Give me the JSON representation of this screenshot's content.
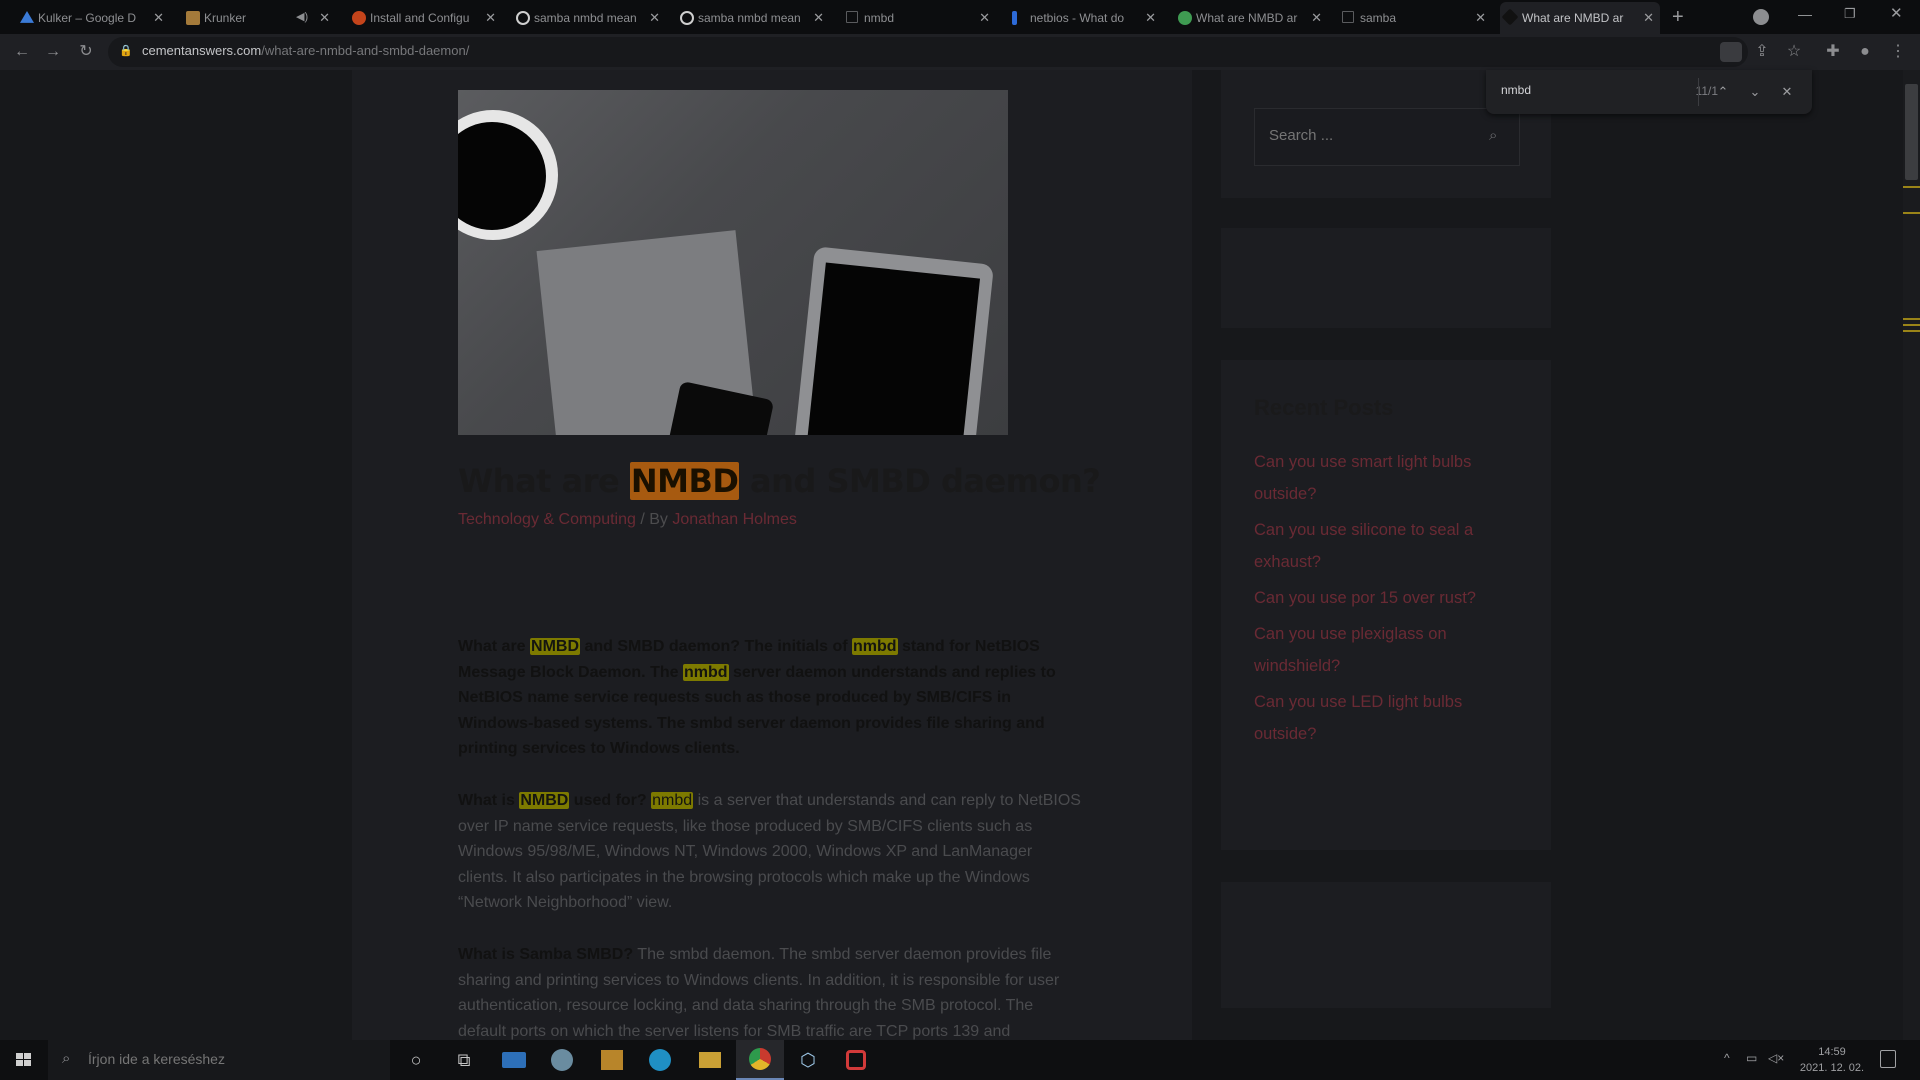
{
  "tabs": [
    {
      "label": "Kulker – Google D",
      "favicon": "google-drive-icon",
      "color": "#3b7bd8"
    },
    {
      "label": "Krunker",
      "favicon": "krunker-icon",
      "color": "#a47a3a",
      "muted_icon": "speaker-icon"
    },
    {
      "label": "Install and Configu",
      "favicon": "ubuntu-icon",
      "color": "#c4441b"
    },
    {
      "label": "samba nmbd mean",
      "favicon": "google-icon",
      "color": "#d8d8d8"
    },
    {
      "label": "samba nmbd mean",
      "favicon": "google-icon",
      "color": "#d8d8d8"
    },
    {
      "label": "nmbd",
      "favicon": "doc-icon",
      "color": "#3a3b3e"
    },
    {
      "label": "netbios - What do",
      "favicon": "serverfault-icon",
      "color": "#2d6ad8"
    },
    {
      "label": "What are NMBD ar",
      "favicon": "globe-icon",
      "color": "#3f9b52"
    },
    {
      "label": "samba",
      "favicon": "doc-icon",
      "color": "#3a3b3e"
    },
    {
      "label": "What are NMBD ar",
      "favicon": "site-icon",
      "color": "#4a4a4a",
      "active": true
    }
  ],
  "address_bar": {
    "domain": "cementanswers.com",
    "path": "/what-are-nmbd-and-smbd-daemon/"
  },
  "find_bar": {
    "query": "nmbd",
    "count": "11/1"
  },
  "article": {
    "title_prefix": "What are ",
    "title_highlight": "NMBD",
    "title_suffix": " and SMBD daemon?",
    "category": "Technology & Computing",
    "by": " / By ",
    "author": "Jonathan Holmes",
    "p1": {
      "a": "What are ",
      "b": "NMBD",
      "c": " and SMBD daemon? The initials of ",
      "d": "nmbd",
      "e": " stand for NetBIOS Message Block Daemon. The ",
      "f": "nmbd",
      "g": " server daemon understands and replies to NetBIOS name service requests such as those produced by SMB/CIFS in Windows-based systems. The smbd server daemon provides file sharing and printing services to Windows clients."
    },
    "p2": {
      "q1": "What is ",
      "q2": "NMBD",
      "q3": " used for?",
      "h": "nmbd",
      "rest": " is a server that understands and can reply to NetBIOS over IP name service requests, like those produced by SMB/CIFS clients such as Windows 95/98/ME, Windows NT, Windows 2000, Windows XP and LanManager clients. It also participates in the browsing protocols which make up the Windows “Network Neighborhood” view."
    },
    "p3": {
      "q": "What is Samba SMBD?",
      "rest": " The smbd daemon. The smbd server daemon provides file sharing and printing services to Windows clients. In addition, it is responsible for user authentication, resource locking, and data sharing through the SMB protocol. The default ports on which the server listens for SMB traffic are TCP ports 139 and"
    }
  },
  "sidebar": {
    "search_placeholder": "Search ...",
    "recent_title": "Recent Posts",
    "recent_posts": [
      "Can you use smart light bulbs outside?",
      "Can you use silicone to seal a exhaust?",
      "Can you use por 15 over rust?",
      "Can you use plexiglass on windshield?",
      "Can you use LED light bulbs outside?"
    ]
  },
  "taskbar": {
    "search_placeholder": "Írjon ide a kereséshez",
    "time": "14:59",
    "date": "2021. 12. 02."
  },
  "colors": {
    "accent_link": "#6a2a34",
    "highlight": "#7d7a00",
    "highlight_active": "#a75a10"
  }
}
